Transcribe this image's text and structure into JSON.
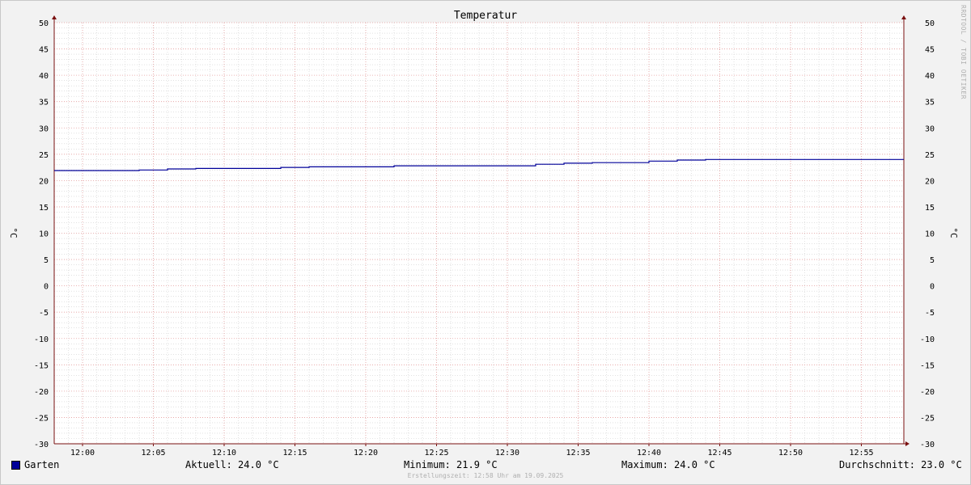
{
  "chart_data": {
    "type": "line",
    "title": "Temperatur",
    "ylabel": "°C",
    "ylabel_right": "°C",
    "ylim": [
      -30,
      50
    ],
    "yticks": [
      "50",
      "45",
      "40",
      "35",
      "30",
      "25",
      "20",
      "15",
      "10",
      "5",
      "0",
      "-5",
      "-10",
      "-15",
      "-20",
      "-25",
      "-30"
    ],
    "xlim": [
      "11:58",
      "12:58"
    ],
    "xticks": [
      "12:00",
      "12:05",
      "12:10",
      "12:15",
      "12:20",
      "12:25",
      "12:30",
      "12:35",
      "12:40",
      "12:45",
      "12:50",
      "12:55"
    ],
    "grid": true,
    "series": [
      {
        "name": "Garten",
        "color": "#000099",
        "points": [
          [
            "11:58",
            21.9
          ],
          [
            "12:04",
            21.9
          ],
          [
            "12:04",
            22.0
          ],
          [
            "12:06",
            22.0
          ],
          [
            "12:06",
            22.2
          ],
          [
            "12:08",
            22.2
          ],
          [
            "12:08",
            22.3
          ],
          [
            "12:14",
            22.3
          ],
          [
            "12:14",
            22.5
          ],
          [
            "12:16",
            22.5
          ],
          [
            "12:16",
            22.6
          ],
          [
            "12:22",
            22.6
          ],
          [
            "12:22",
            22.8
          ],
          [
            "12:32",
            22.8
          ],
          [
            "12:32",
            23.1
          ],
          [
            "12:34",
            23.1
          ],
          [
            "12:34",
            23.3
          ],
          [
            "12:36",
            23.3
          ],
          [
            "12:36",
            23.4
          ],
          [
            "12:40",
            23.4
          ],
          [
            "12:40",
            23.7
          ],
          [
            "12:42",
            23.7
          ],
          [
            "12:42",
            23.9
          ],
          [
            "12:44",
            23.9
          ],
          [
            "12:44",
            24.0
          ],
          [
            "12:58",
            24.0
          ]
        ]
      }
    ],
    "legend": {
      "series_label": "Garten",
      "aktuell": "Aktuell: 24.0 °C",
      "minimum": "Minimum: 21.9 °C",
      "maximum": "Maximum: 24.0 °C",
      "durchschnitt": "Durchschnitt: 23.0 °C"
    },
    "footer": "Erstellungszeit: 12:58 Uhr am 19.09.2025",
    "watermark": "RRDTOOL / TOBI OETIKER",
    "colors": {
      "major_grid": "#e8a0a0",
      "minor_grid": "#cfcfcf",
      "axis": "#7a1010",
      "plot_bg": "#ffffff"
    }
  }
}
